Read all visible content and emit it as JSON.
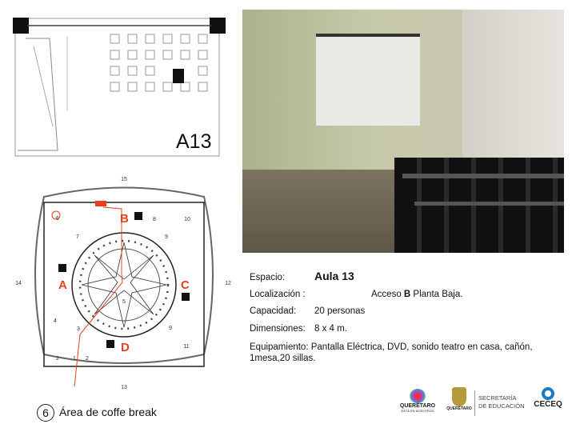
{
  "plan_top": {
    "room_label": "A13"
  },
  "floor_plan": {
    "access_labels": [
      "A",
      "B",
      "C",
      "D"
    ],
    "zone_numbers": [
      "15",
      "14",
      "12",
      "13",
      "10",
      "9",
      "8",
      "7",
      "6",
      "5",
      "4",
      "3",
      "2",
      "1",
      "2",
      "9",
      "11"
    ]
  },
  "info": {
    "espacio_label": "Espacio:",
    "espacio_value": "Aula 13",
    "localizacion_label": "Localización :",
    "localizacion_pre": "Acceso ",
    "localizacion_bold": "B",
    "localizacion_post": " Planta Baja.",
    "capacidad_label": "Capacidad:",
    "capacidad_value": "20 personas",
    "dimensiones_label": "Dimensiones:",
    "dimensiones_value": "8 x 4 m.",
    "equipamiento_label": "Equipamiento:",
    "equipamiento_value": " Pantalla Eléctrica, DVD, sonido teatro en casa, cañón, 1mesa,20 sillas."
  },
  "legend": {
    "number": "6",
    "text": "Área de coffe break"
  },
  "logos": {
    "queretaro": "QUERÉTARO",
    "queretaro_sub": "ESTÁ EN NOSOTROS",
    "gobierno": "QUERÉTARO",
    "secretaria": "SECRETARÍA",
    "educacion": "DE EDUCACIÓN",
    "ceceq": "CECEQ"
  },
  "colors": {
    "accent": "#e8401c"
  }
}
